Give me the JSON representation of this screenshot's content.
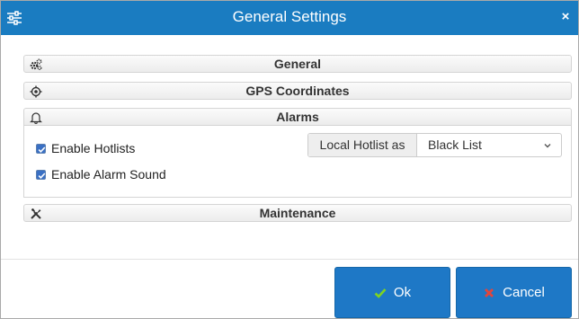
{
  "dialog": {
    "title": "General Settings",
    "close_label": "×"
  },
  "sections": {
    "general": {
      "label": "General",
      "icon": "gears-icon"
    },
    "gps": {
      "label": "GPS Coordinates",
      "icon": "crosshair-icon"
    },
    "alarms": {
      "label": "Alarms",
      "icon": "bell-icon"
    },
    "maintenance": {
      "label": "Maintenance",
      "icon": "tools-icon"
    }
  },
  "alarms": {
    "enable_hotlists": {
      "label": "Enable Hotlists",
      "checked": true
    },
    "enable_alarm_sound": {
      "label": "Enable Alarm Sound",
      "checked": true
    },
    "local_hotlist_label": "Local Hotlist as",
    "local_hotlist_value": "Black List"
  },
  "buttons": {
    "ok": "Ok",
    "cancel": "Cancel"
  },
  "colors": {
    "accent": "#1a7cc1",
    "button": "#1e78c6",
    "ok_check": "#7ed321",
    "cancel_x": "#e2453c"
  }
}
